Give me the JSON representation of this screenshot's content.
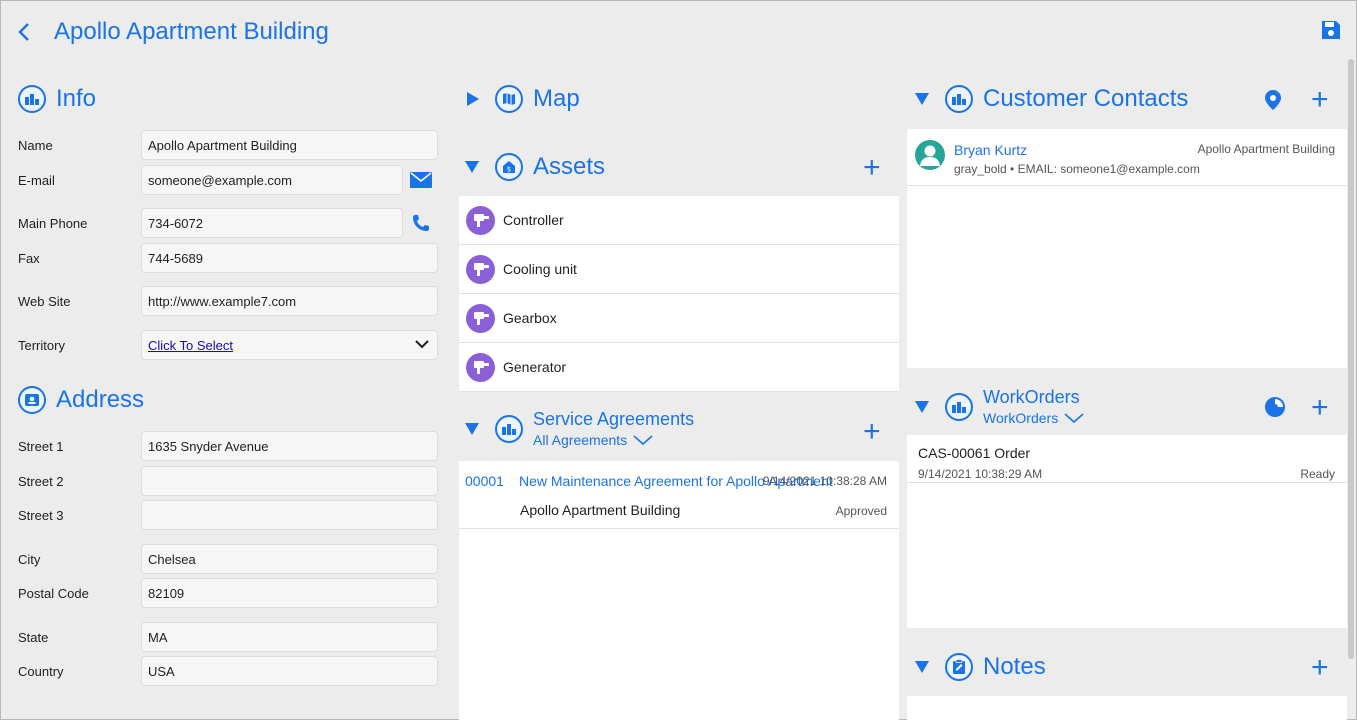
{
  "header": {
    "title": "Apollo Apartment Building"
  },
  "info": {
    "section_title": "Info",
    "fields": [
      {
        "label": "Name",
        "value": "Apollo Apartment Building"
      },
      {
        "label": "E-mail",
        "value": "someone@example.com"
      },
      {
        "label": "Main Phone",
        "value": "734-6072"
      },
      {
        "label": "Fax",
        "value": "744-5689"
      },
      {
        "label": "Web Site",
        "value": "http://www.example7.com"
      },
      {
        "label": "Territory",
        "value": "Click To Select"
      }
    ]
  },
  "address": {
    "section_title": "Address",
    "fields": [
      {
        "label": "Street 1",
        "value": "1635 Snyder Avenue"
      },
      {
        "label": "Street 2",
        "value": ""
      },
      {
        "label": "Street 3",
        "value": ""
      },
      {
        "label": "City",
        "value": "Chelsea"
      },
      {
        "label": "Postal Code",
        "value": "82109"
      },
      {
        "label": "State",
        "value": "MA"
      },
      {
        "label": "Country",
        "value": "USA"
      }
    ]
  },
  "map": {
    "section_title": "Map"
  },
  "assets": {
    "section_title": "Assets",
    "items": [
      "Controller",
      "Cooling unit",
      "Gearbox",
      "Generator"
    ]
  },
  "service_agreements": {
    "section_title": "Service Agreements",
    "filter": "All Agreements",
    "rows": [
      {
        "number": "00001",
        "title": "New Maintenance Agreement for Apollo Apartment",
        "timestamp": "9/14/2021 10:38:28 AM",
        "account": "Apollo Apartment Building",
        "status": "Approved"
      }
    ]
  },
  "customer_contacts": {
    "section_title": "Customer Contacts",
    "contacts": [
      {
        "name": "Bryan Kurtz",
        "account": "Apollo Apartment Building",
        "details": "gray_bold • EMAIL: someone1@example.com"
      }
    ]
  },
  "workorders": {
    "section_title": "WorkOrders",
    "filter": "WorkOrders",
    "rows": [
      {
        "title": "CAS-00061 Order",
        "timestamp": "9/14/2021 10:38:29 AM",
        "status": "Ready"
      }
    ]
  },
  "notes": {
    "section_title": "Notes"
  },
  "colors": {
    "accent": "#1a73e8",
    "asset_icon": "#8b5fd6",
    "avatar": "#26a69a"
  },
  "icons": [
    "back-arrow-icon",
    "save-icon",
    "building-icon",
    "envelope-icon",
    "phone-icon",
    "chevron-down-icon",
    "address-card-icon",
    "map-icon",
    "asset-icon",
    "plus-icon",
    "location-pin-icon",
    "chart-icon",
    "notes-icon",
    "person-icon"
  ]
}
